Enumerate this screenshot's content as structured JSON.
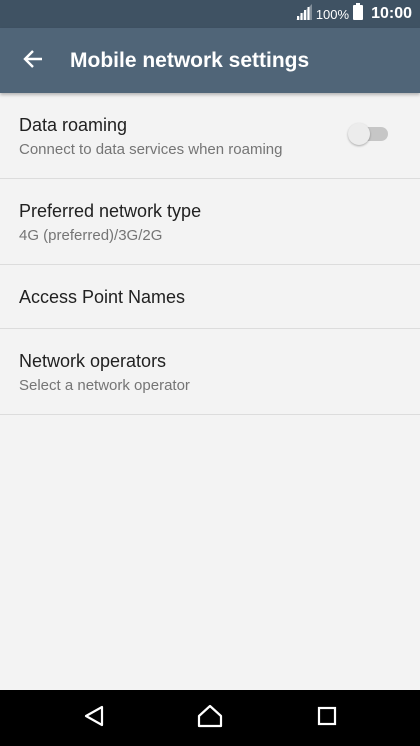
{
  "status_bar": {
    "battery_percent": "100%",
    "time": "10:00",
    "icons": [
      "signal-icon",
      "battery-icon"
    ]
  },
  "app_bar": {
    "title": "Mobile network settings",
    "back_icon": "arrow-left-icon"
  },
  "settings": [
    {
      "title": "Data roaming",
      "subtitle": "Connect to data services when roaming",
      "toggle_on": false
    },
    {
      "title": "Preferred network type",
      "subtitle": "4G (preferred)/3G/2G"
    },
    {
      "title": "Access Point Names"
    },
    {
      "title": "Network operators",
      "subtitle": "Select a network operator"
    }
  ],
  "nav_bar": {
    "icons": [
      "back-triangle-icon",
      "home-icon",
      "recents-square-icon"
    ]
  },
  "colors": {
    "status_bar": "#3f5263",
    "app_bar": "#506578",
    "background": "#f3f3f3",
    "nav_bar": "#000000"
  }
}
